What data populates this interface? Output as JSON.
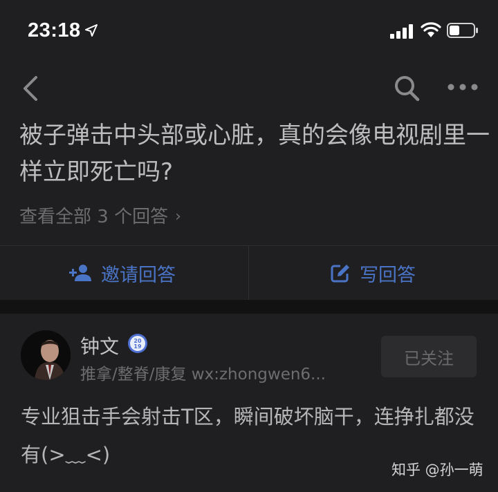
{
  "status_bar": {
    "time": "23:18"
  },
  "question": {
    "title": "被子弹击中头部或心脏，真的会像电视剧里一样立即死亡吗?",
    "view_all": "查看全部 3 个回答",
    "view_all_chevron": "›"
  },
  "actions": {
    "invite_label": "邀请回答",
    "write_label": "写回答",
    "accent_color": "#4a74c6"
  },
  "answer": {
    "author_name": "钟文",
    "badge": {
      "line1": "20",
      "line2": "19"
    },
    "author_bio": "推拿/整脊/康复 wx:zhongwen6...",
    "follow_label": "已关注",
    "text": "专业狙击手会射击T区，瞬间破坏脑干，连挣扎都没有(>﹏<)"
  },
  "watermark": "知乎 @孙一萌",
  "icons": [
    "location-arrow-icon",
    "signal-icon",
    "wifi-icon",
    "battery-icon",
    "back-icon",
    "search-icon",
    "more-icon",
    "add-user-icon",
    "edit-icon",
    "badge-icon"
  ]
}
